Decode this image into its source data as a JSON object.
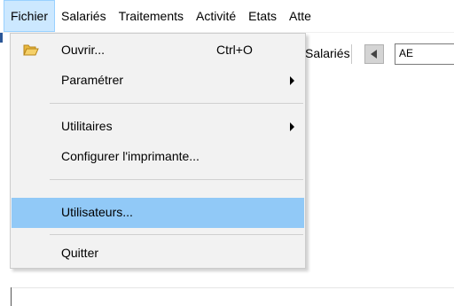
{
  "menubar": {
    "items": [
      "Fichier",
      "Salariés",
      "Traitements",
      "Activité",
      "Etats",
      "Atte"
    ]
  },
  "toolbar": {
    "label": "Salariés",
    "input_value": "AE"
  },
  "file_menu": {
    "open": {
      "label": "Ouvrir...",
      "shortcut": "Ctrl+O",
      "icon": "folder-open-icon"
    },
    "parametrer": {
      "label": "Paramétrer"
    },
    "utilitaires": {
      "label": "Utilitaires"
    },
    "configurer": {
      "label": "Configurer l'imprimante..."
    },
    "utilisateurs": {
      "label": "Utilisateurs..."
    },
    "quitter": {
      "label": "Quitter"
    }
  },
  "colors": {
    "menu_bg": "#f2f2f2",
    "hover": "#91c9f7",
    "open_menu": "#cce8ff",
    "folder": "#e8b840"
  }
}
